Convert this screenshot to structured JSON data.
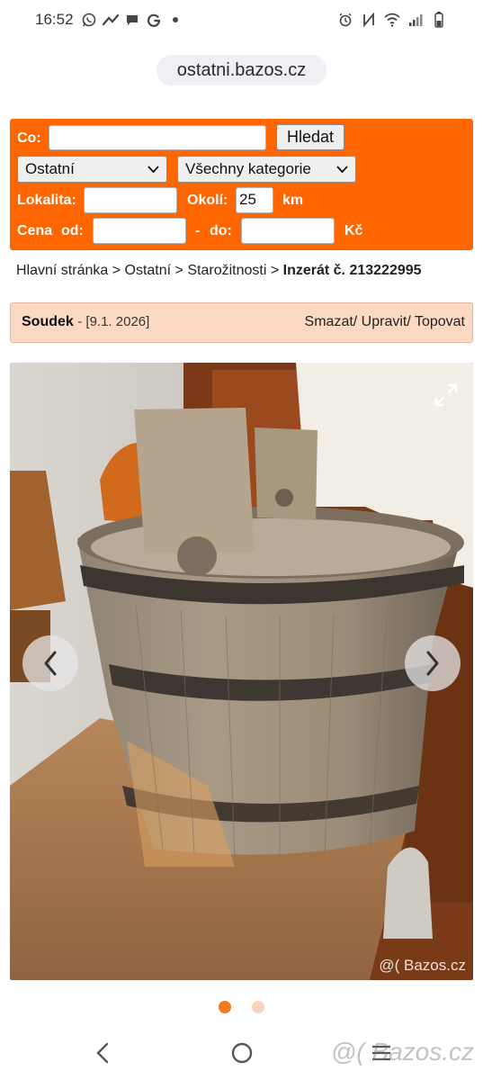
{
  "status_bar": {
    "time": "16:52",
    "left_icons": [
      "whatsapp-icon",
      "messenger-fan-icon",
      "chat-bubble-icon",
      "google-g-icon",
      "dot-icon"
    ],
    "right_icons": [
      "alarm-icon",
      "nfc-icon",
      "wifi-icon",
      "signal-icon",
      "battery-icon"
    ]
  },
  "browser": {
    "url": "ostatni.bazos.cz"
  },
  "search": {
    "co_label": "Co:",
    "co_value": "",
    "search_button": "Hledat",
    "section_select": "Ostatní",
    "category_select": "Všechny kategorie",
    "lokalita_label": "Lokalita:",
    "lokalita_value": "",
    "okoli_label": "Okolí:",
    "okoli_value": "25",
    "km_label": "km",
    "cena_label": "Cena",
    "od_label": "od:",
    "od_value": "",
    "dash": "-",
    "do_label": "do:",
    "do_value": "",
    "currency": "Kč"
  },
  "breadcrumb": {
    "home": "Hlavní stránka",
    "sep": ">",
    "section": "Ostatní",
    "category": "Starožitnosti",
    "current": "Inzerát č. 213222995"
  },
  "listing": {
    "title": "Soudek",
    "date": "- [9.1. 2026]",
    "actions": "Smazat/ Upravit/ Topovat"
  },
  "photo": {
    "watermark": "@( Bazos.cz",
    "prev_icon": "chevron-left-icon",
    "next_icon": "chevron-right-icon",
    "expand_icon": "expand-icon",
    "total_images": 2,
    "active_image": 1
  },
  "colors": {
    "accent": "#ff6600",
    "title_bg": "#fdd9c4",
    "dot_active": "#f47a20",
    "dot_inactive": "#fbd3bb"
  },
  "nav_bar": {
    "back_icon": "back-chevron-icon",
    "home_icon": "home-circle-icon",
    "recents_icon": "recents-lines-icon",
    "watermark": "@( Bazos.cz"
  }
}
